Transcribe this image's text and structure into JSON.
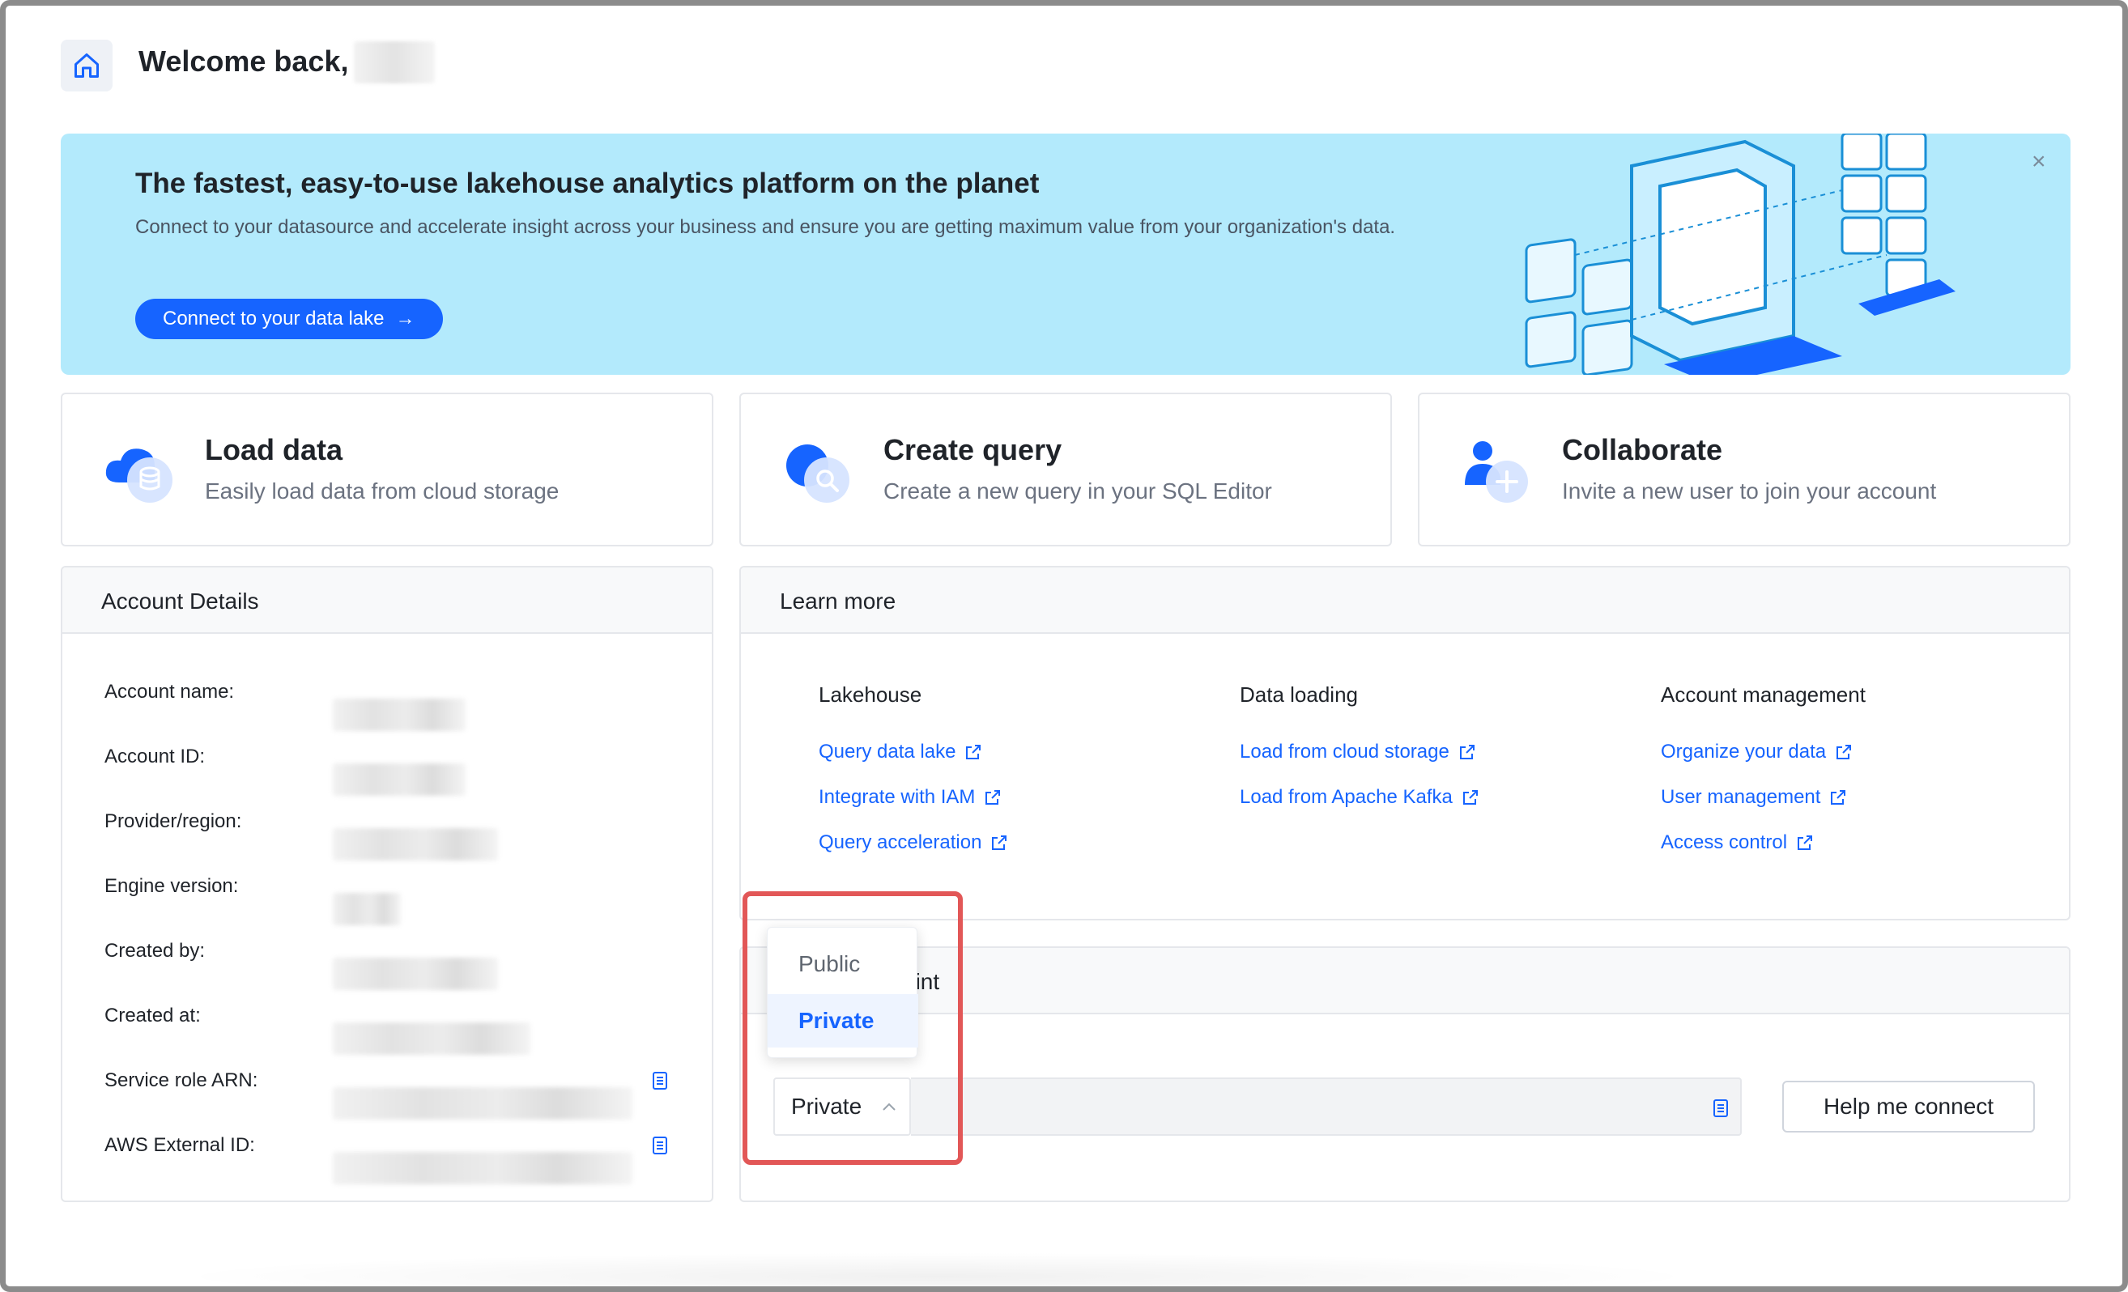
{
  "header": {
    "welcome": "Welcome back,",
    "home_icon": "home-icon"
  },
  "banner": {
    "title": "The fastest, easy-to-use lakehouse analytics platform on the planet",
    "description": "Connect to your datasource and accelerate insight across your business and ensure you are getting maximum value from your organization's data.",
    "button_label": "Connect to your data lake",
    "close": "×",
    "background": "#b3eafc",
    "accent": "#1664ff"
  },
  "actions": [
    {
      "title": "Load data",
      "subtitle": "Easily load data from cloud storage",
      "icon": "cloud-database-icon"
    },
    {
      "title": "Create query",
      "subtitle": "Create a new query in your SQL Editor",
      "icon": "search-query-icon"
    },
    {
      "title": "Collaborate",
      "subtitle": "Invite a new user to join your account",
      "icon": "add-user-icon"
    }
  ],
  "account": {
    "title": "Account Details",
    "labels": [
      "Account name:",
      "Account ID:",
      "Provider/region:",
      "Engine version:",
      "Created by:",
      "Created at:",
      "Service role ARN:",
      "AWS External ID:"
    ]
  },
  "learn_more": {
    "title": "Learn more",
    "columns": [
      {
        "title": "Lakehouse",
        "links": [
          "Query data lake",
          "Integrate with IAM",
          "Query acceleration"
        ]
      },
      {
        "title": "Data loading",
        "links": [
          "Load from cloud storage",
          "Load from Apache Kafka"
        ]
      },
      {
        "title": "Account management",
        "links": [
          "Organize your data",
          "User management",
          "Access control"
        ]
      }
    ]
  },
  "endpoint": {
    "title_fragment": "oint",
    "selected": "Private",
    "options": [
      "Public",
      "Private"
    ],
    "help_button": "Help me connect"
  },
  "colors": {
    "highlight": "#e25757",
    "link": "#1664ff"
  }
}
